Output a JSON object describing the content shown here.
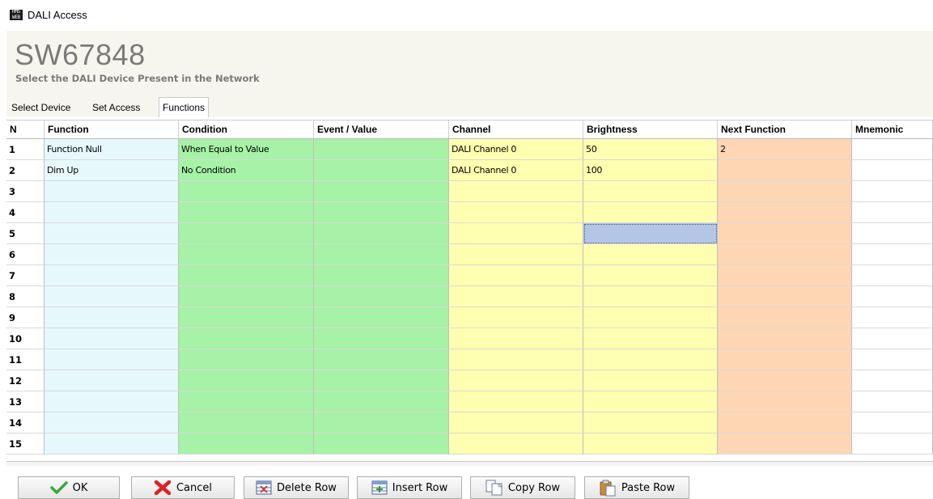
{
  "window": {
    "title": "DALI Access",
    "icon_text": "HMS WEB"
  },
  "header": {
    "model": "SW67848",
    "subtitle": "Select the DALI Device Present in the  Network"
  },
  "tabs": [
    {
      "label": "Select Device",
      "active": false
    },
    {
      "label": "Set Access",
      "active": false
    },
    {
      "label": "Functions",
      "active": true
    }
  ],
  "table": {
    "columns": [
      "N",
      "Function",
      "Condition",
      "Event / Value",
      "Channel",
      "Brightness",
      "Next Function",
      "Mnemonic"
    ],
    "rows": [
      [
        "1",
        "Function Null",
        "When Equal to Value",
        "",
        "DALI Channel 0",
        "50",
        "2",
        ""
      ],
      [
        "2",
        "Dim Up",
        "No Condition",
        "",
        "DALI Channel 0",
        "100",
        "",
        ""
      ],
      [
        "3",
        "",
        "",
        "",
        "",
        "",
        "",
        ""
      ],
      [
        "4",
        "",
        "",
        "",
        "",
        "",
        "",
        ""
      ],
      [
        "5",
        "",
        "",
        "",
        "",
        "",
        "",
        ""
      ],
      [
        "6",
        "",
        "",
        "",
        "",
        "",
        "",
        ""
      ],
      [
        "7",
        "",
        "",
        "",
        "",
        "",
        "",
        ""
      ],
      [
        "8",
        "",
        "",
        "",
        "",
        "",
        "",
        ""
      ],
      [
        "9",
        "",
        "",
        "",
        "",
        "",
        "",
        ""
      ],
      [
        "10",
        "",
        "",
        "",
        "",
        "",
        "",
        ""
      ],
      [
        "11",
        "",
        "",
        "",
        "",
        "",
        "",
        ""
      ],
      [
        "12",
        "",
        "",
        "",
        "",
        "",
        "",
        ""
      ],
      [
        "13",
        "",
        "",
        "",
        "",
        "",
        "",
        ""
      ],
      [
        "14",
        "",
        "",
        "",
        "",
        "",
        "",
        ""
      ],
      [
        "15",
        "",
        "",
        "",
        "",
        "",
        "",
        ""
      ]
    ],
    "selected_cell": {
      "row": "5",
      "column": "Brightness"
    }
  },
  "buttons": {
    "ok": "OK",
    "cancel": "Cancel",
    "delete_row": "Delete Row",
    "insert_row": "Insert Row",
    "copy_row": "Copy Row",
    "paste_row": "Paste Row"
  },
  "colors": {
    "function_column": "#e6f8fc",
    "condition_column": "#a6f2a6",
    "event_column": "#a6f2a6",
    "channel_column": "#ffffb0",
    "brightness_column": "#ffffb0",
    "next_function_column": "#ffd6b3",
    "selected_cell": "#b3c6e6"
  },
  "icons": {
    "ok": "checkmark-icon",
    "cancel": "red-x-icon",
    "delete_row": "delete-row-icon",
    "insert_row": "insert-row-icon",
    "copy_row": "copy-icon",
    "paste_row": "paste-icon"
  }
}
